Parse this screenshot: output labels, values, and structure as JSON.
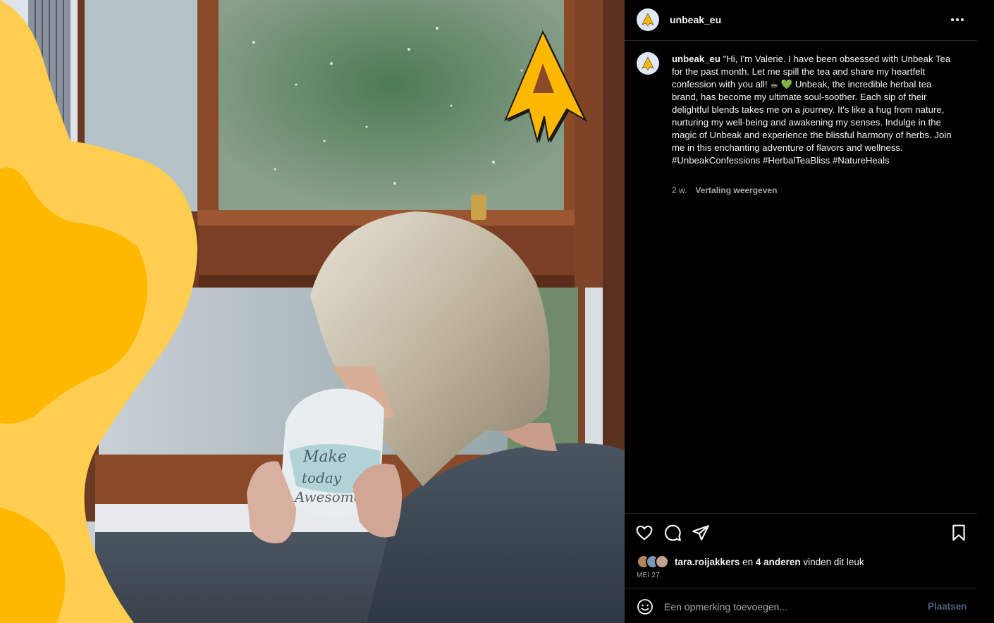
{
  "post": {
    "username": "unbeak_eu",
    "caption_username": "unbeak_eu",
    "caption_text": " \"Hi, I'm Valerie. I have been obsessed with Unbeak Tea for the past month. Let me spill the tea and share my heartfelt confession with you all! ☕ 💚 Unbeak, the incredible herbal tea brand, has become my ultimate soul-soother. Each sip of their delightful blends takes me on a journey. It's like a hug from nature, nurturing my well-being and awakening my senses. Indulge in the magic of Unbeak and experience the blissful harmony of herbs. Join me in this enchanting adventure of flavors and wellness. #UnbeakConfessions #HerbalTeaBliss #NatureHeals",
    "age": "2 w.",
    "translate_label": "Vertaling weergeven",
    "likes": {
      "first_liker": "tara.roijakkers",
      "connector": " en ",
      "others": "4 anderen",
      "suffix": " vinden dit leuk"
    },
    "date": "MEI 27"
  },
  "comment": {
    "placeholder": "Een opmerking toevoegen...",
    "post_label": "Plaatsen"
  },
  "icons": {
    "more": "more-horizontal-icon",
    "like": "heart-icon",
    "comment": "comment-icon",
    "share": "share-icon",
    "save": "bookmark-icon",
    "emoji": "emoji-icon",
    "brand_logo": "unbeak-logo"
  },
  "colors": {
    "brand_yellow": "#ffcd4f",
    "brand_orange": "#ffb800",
    "background": "#000000",
    "post_button": "#4b5e7a"
  }
}
